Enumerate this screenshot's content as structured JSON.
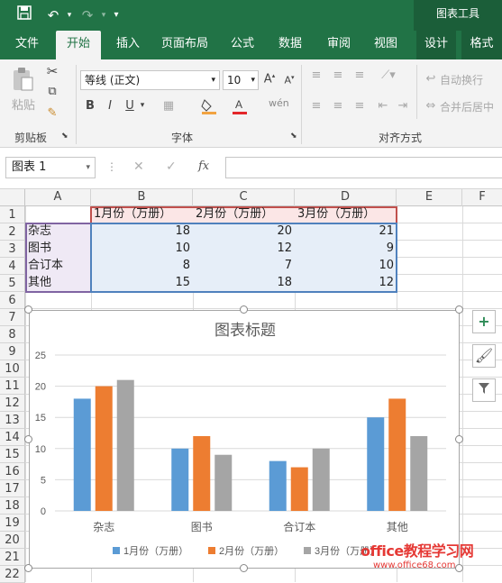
{
  "contextual_tab": "图表工具",
  "tabs": [
    "文件",
    "开始",
    "插入",
    "页面布局",
    "公式",
    "数据",
    "审阅",
    "视图",
    "设计",
    "格式"
  ],
  "ribbon": {
    "paste_label": "粘贴",
    "font_name": "等线 (正文)",
    "font_size": "10",
    "wrap_text": "自动换行",
    "merge_center": "合并后居中",
    "groups": [
      "剪贴板",
      "字体",
      "对齐方式"
    ]
  },
  "namebox": "图表 1",
  "columns": [
    "A",
    "B",
    "C",
    "D",
    "E",
    "F"
  ],
  "rows": [
    "1",
    "2",
    "3",
    "4",
    "5",
    "6",
    "7",
    "8",
    "9",
    "10",
    "11",
    "12",
    "13",
    "14",
    "15",
    "16",
    "17",
    "18",
    "19",
    "20",
    "21",
    "22"
  ],
  "table": {
    "headers": [
      "1月份（万册）",
      "2月份（万册）",
      "3月份（万册）"
    ],
    "rows": [
      {
        "label": "杂志",
        "v": [
          "18",
          "20",
          "21"
        ]
      },
      {
        "label": "图书",
        "v": [
          "10",
          "12",
          "9"
        ]
      },
      {
        "label": "合订本",
        "v": [
          "8",
          "7",
          "10"
        ]
      },
      {
        "label": "其他",
        "v": [
          "15",
          "18",
          "12"
        ]
      }
    ]
  },
  "chart_data": {
    "type": "bar",
    "title": "图表标题",
    "categories": [
      "杂志",
      "图书",
      "合订本",
      "其他"
    ],
    "series": [
      {
        "name": "1月份（万册）",
        "values": [
          18,
          10,
          8,
          15
        ],
        "color": "#5b9bd5"
      },
      {
        "name": "2月份（万册）",
        "values": [
          20,
          12,
          7,
          18
        ],
        "color": "#ed7d31"
      },
      {
        "name": "3月份（万册）",
        "values": [
          21,
          9,
          10,
          12
        ],
        "color": "#a5a5a5"
      }
    ],
    "yticks": [
      "0",
      "5",
      "10",
      "15",
      "20",
      "25"
    ],
    "ylim": [
      0,
      25
    ],
    "grid": true,
    "legend_position": "bottom"
  },
  "watermark": {
    "line1": "office教程学习网",
    "line2": "www.office68.com"
  }
}
